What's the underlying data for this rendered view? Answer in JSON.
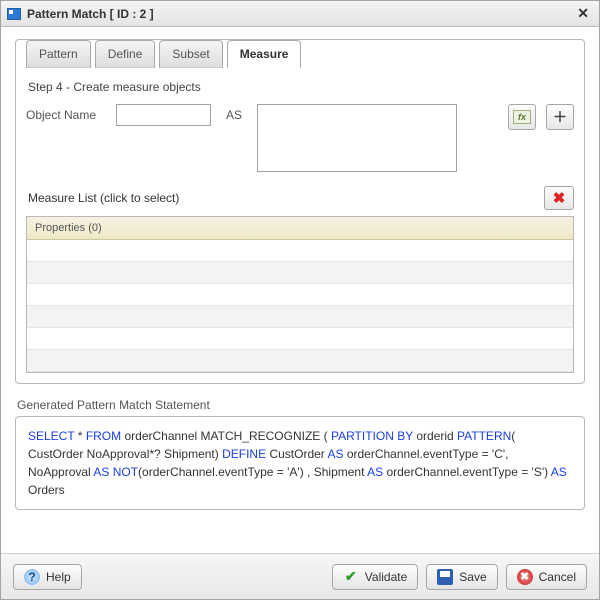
{
  "title": "Pattern Match [ ID : 2 ]",
  "tabs": {
    "pattern": "Pattern",
    "define": "Define",
    "subset": "Subset",
    "measure": "Measure"
  },
  "step_label": "Step 4 - Create measure objects",
  "labels": {
    "object_name": "Object Name",
    "as": "AS",
    "measure_list": "Measure List (click to select)",
    "properties_header": "Properties (0)",
    "generated": "Generated Pattern Match Statement"
  },
  "statement": {
    "s1": "SELECT",
    "s2": " * ",
    "s3": "FROM",
    "s4": " orderChannel  MATCH_RECOGNIZE ( ",
    "s5": "PARTITION BY",
    "s6": " orderid ",
    "s7": "PATTERN",
    "s8": "( CustOrder NoApproval*? Shipment) ",
    "s9": "DEFINE",
    "s10": " CustOrder ",
    "s11": "AS",
    "s12": " orderChannel.eventType = 'C', NoApproval ",
    "s13": "AS NOT",
    "s14": "(orderChannel.eventType = 'A') , Shipment ",
    "s15": "AS",
    "s16": " orderChannel.eventType = 'S') ",
    "s17": "AS",
    "s18": " Orders"
  },
  "buttons": {
    "help": "Help",
    "validate": "Validate",
    "save": "Save",
    "cancel": "Cancel"
  }
}
